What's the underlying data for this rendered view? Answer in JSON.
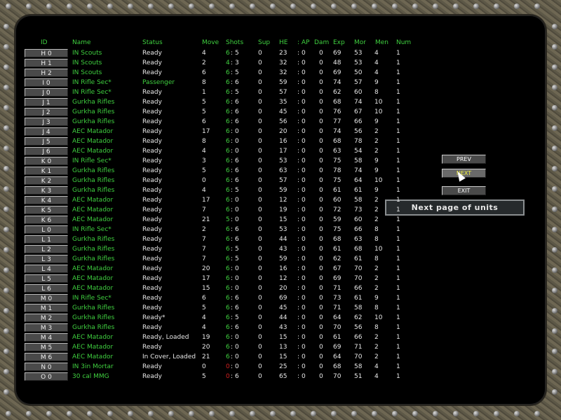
{
  "headers": [
    "ID",
    "Name",
    "Status",
    "Move",
    "Shots",
    "Sup",
    "HE",
    ": AP",
    "Dam",
    "Exp",
    "Mor",
    "Men",
    "Num"
  ],
  "rows": [
    [
      "H 0",
      "IN Scouts",
      "Ready",
      "4",
      "6",
      "5",
      "0",
      "23",
      "0",
      "0",
      "69",
      "53",
      "4",
      "1"
    ],
    [
      "H 1",
      "IN Scouts",
      "Ready",
      "2",
      "4",
      "3",
      "0",
      "32",
      "0",
      "0",
      "48",
      "53",
      "4",
      "1"
    ],
    [
      "H 2",
      "IN Scouts",
      "Ready",
      "6",
      "6",
      "5",
      "0",
      "32",
      "0",
      "0",
      "69",
      "50",
      "4",
      "1"
    ],
    [
      "I 0",
      "IN Rifle Sec*",
      "Passenger",
      "8",
      "6",
      "6",
      "0",
      "59",
      "0",
      "0",
      "74",
      "57",
      "9",
      "1"
    ],
    [
      "J 0",
      "IN Rifle Sec*",
      "Ready",
      "1",
      "6",
      "5",
      "0",
      "57",
      "0",
      "0",
      "62",
      "60",
      "8",
      "1"
    ],
    [
      "J 1",
      "Gurkha Rifles",
      "Ready",
      "5",
      "6",
      "6",
      "0",
      "35",
      "0",
      "0",
      "68",
      "74",
      "10",
      "1"
    ],
    [
      "J 2",
      "Gurkha Rifles",
      "Ready",
      "5",
      "6",
      "6",
      "0",
      "45",
      "0",
      "0",
      "76",
      "67",
      "10",
      "1"
    ],
    [
      "J 3",
      "Gurkha Rifles",
      "Ready",
      "6",
      "6",
      "6",
      "0",
      "56",
      "0",
      "0",
      "77",
      "66",
      "9",
      "1"
    ],
    [
      "J 4",
      "AEC Matador",
      "Ready",
      "17",
      "6",
      "0",
      "0",
      "20",
      "0",
      "0",
      "74",
      "56",
      "2",
      "1"
    ],
    [
      "J 5",
      "AEC Matador",
      "Ready",
      "8",
      "6",
      "0",
      "0",
      "16",
      "0",
      "0",
      "68",
      "78",
      "2",
      "1"
    ],
    [
      "J 6",
      "AEC Matador",
      "Ready",
      "4",
      "6",
      "0",
      "0",
      "17",
      "0",
      "0",
      "63",
      "54",
      "2",
      "1"
    ],
    [
      "K 0",
      "IN Rifle Sec*",
      "Ready",
      "3",
      "6",
      "6",
      "0",
      "53",
      "0",
      "0",
      "75",
      "58",
      "9",
      "1"
    ],
    [
      "K 1",
      "Gurkha Rifles",
      "Ready",
      "5",
      "6",
      "6",
      "0",
      "63",
      "0",
      "0",
      "78",
      "74",
      "9",
      "1"
    ],
    [
      "K 2",
      "Gurkha Rifles",
      "Ready",
      "0",
      "6",
      "6",
      "0",
      "57",
      "0",
      "0",
      "75",
      "64",
      "10",
      "1"
    ],
    [
      "K 3",
      "Gurkha Rifles",
      "Ready",
      "4",
      "6",
      "5",
      "0",
      "59",
      "0",
      "0",
      "61",
      "61",
      "9",
      "1"
    ],
    [
      "K 4",
      "AEC Matador",
      "Ready",
      "17",
      "6",
      "0",
      "0",
      "12",
      "0",
      "0",
      "60",
      "58",
      "2",
      "1"
    ],
    [
      "K 5",
      "AEC Matador",
      "Ready",
      "7",
      "6",
      "0",
      "0",
      "19",
      "0",
      "0",
      "72",
      "73",
      "2",
      "1"
    ],
    [
      "K 6",
      "AEC Matador",
      "Ready",
      "21",
      "5",
      "0",
      "0",
      "15",
      "0",
      "0",
      "59",
      "60",
      "2",
      "1"
    ],
    [
      "L 0",
      "IN Rifle Sec*",
      "Ready",
      "2",
      "6",
      "6",
      "0",
      "53",
      "0",
      "0",
      "75",
      "66",
      "8",
      "1"
    ],
    [
      "L 1",
      "Gurkha Rifles",
      "Ready",
      "7",
      "6",
      "6",
      "0",
      "44",
      "0",
      "0",
      "68",
      "63",
      "8",
      "1"
    ],
    [
      "L 2",
      "Gurkha Rifles",
      "Ready",
      "7",
      "6",
      "5",
      "0",
      "43",
      "0",
      "0",
      "61",
      "68",
      "10",
      "1"
    ],
    [
      "L 3",
      "Gurkha Rifles",
      "Ready",
      "7",
      "6",
      "5",
      "0",
      "59",
      "0",
      "0",
      "62",
      "61",
      "8",
      "1"
    ],
    [
      "L 4",
      "AEC Matador",
      "Ready",
      "20",
      "6",
      "0",
      "0",
      "16",
      "0",
      "0",
      "67",
      "70",
      "2",
      "1"
    ],
    [
      "L 5",
      "AEC Matador",
      "Ready",
      "17",
      "6",
      "0",
      "0",
      "12",
      "0",
      "0",
      "69",
      "70",
      "2",
      "1"
    ],
    [
      "L 6",
      "AEC Matador",
      "Ready",
      "15",
      "6",
      "0",
      "0",
      "20",
      "0",
      "0",
      "71",
      "66",
      "2",
      "1"
    ],
    [
      "M 0",
      "IN Rifle Sec*",
      "Ready",
      "6",
      "6",
      "6",
      "0",
      "69",
      "0",
      "0",
      "73",
      "61",
      "9",
      "1"
    ],
    [
      "M 1",
      "Gurkha Rifles",
      "Ready",
      "5",
      "6",
      "6",
      "0",
      "45",
      "0",
      "0",
      "71",
      "58",
      "8",
      "1"
    ],
    [
      "M 2",
      "Gurkha Rifles",
      "Ready*",
      "4",
      "6",
      "5",
      "0",
      "44",
      "0",
      "0",
      "64",
      "62",
      "10",
      "1"
    ],
    [
      "M 3",
      "Gurkha Rifles",
      "Ready",
      "4",
      "6",
      "6",
      "0",
      "43",
      "0",
      "0",
      "70",
      "56",
      "8",
      "1"
    ],
    [
      "M 4",
      "AEC Matador",
      "Ready,  Loaded",
      "19",
      "6",
      "0",
      "0",
      "15",
      "0",
      "0",
      "61",
      "66",
      "2",
      "1"
    ],
    [
      "M 5",
      "AEC Matador",
      "Ready",
      "20",
      "6",
      "0",
      "0",
      "13",
      "0",
      "0",
      "69",
      "71",
      "2",
      "1"
    ],
    [
      "M 6",
      "AEC Matador",
      "In Cover,  Loaded",
      "21",
      "6",
      "0",
      "0",
      "15",
      "0",
      "0",
      "64",
      "70",
      "2",
      "1"
    ],
    [
      "N 0",
      "IN 3in Mortar",
      "Ready",
      "0",
      "0",
      "0",
      "0",
      "25",
      "0",
      "0",
      "68",
      "58",
      "4",
      "1"
    ],
    [
      "O 0",
      "30 cal MMG",
      "Ready",
      "5",
      "0",
      "6",
      "0",
      "65",
      "0",
      "0",
      "70",
      "51",
      "4",
      "1"
    ]
  ],
  "buttons": {
    "prev": "PREV",
    "next": "NEXT",
    "exit": "EXIT"
  },
  "tooltip": "Next page of units",
  "colors": {
    "green": "#3fcf3f",
    "red": "#d02020",
    "hover": "#f0f040"
  }
}
